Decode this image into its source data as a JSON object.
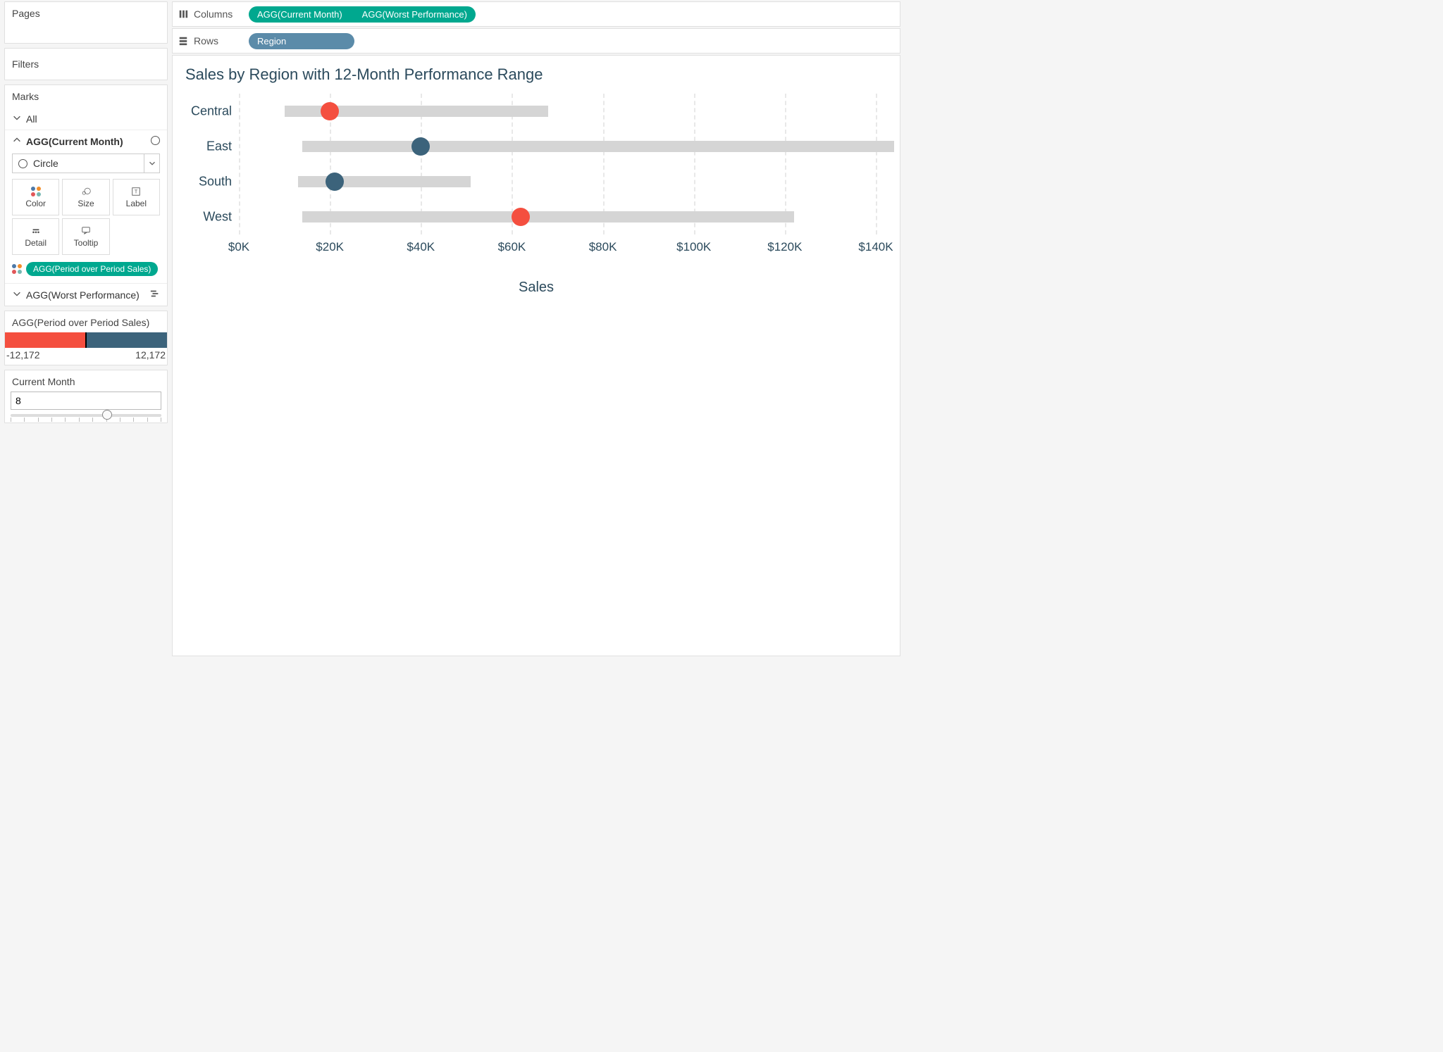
{
  "pages_label": "Pages",
  "filters_label": "Filters",
  "marks": {
    "header": "Marks",
    "all_label": "All",
    "section1_label": "AGG(Current Month)",
    "mark_type": "Circle",
    "cells": {
      "color": "Color",
      "size": "Size",
      "label": "Label",
      "detail": "Detail",
      "tooltip": "Tooltip"
    },
    "color_pill": "AGG(Period over Period Sales)",
    "section2_label": "AGG(Worst Performance)"
  },
  "legend": {
    "title": "AGG(Period over Period Sales)",
    "min": "-12,172",
    "max": "12,172"
  },
  "param": {
    "title": "Current Month",
    "value": "8"
  },
  "shelves": {
    "columns_label": "Columns",
    "rows_label": "Rows",
    "columns": [
      "AGG(Current Month)",
      "AGG(Worst Performance)"
    ],
    "rows": [
      "Region"
    ]
  },
  "viz": {
    "title": "Sales by Region with 12-Month Performance Range",
    "x_title": "Sales"
  },
  "chart_data": {
    "type": "range-dot",
    "x_label": "Sales",
    "x_domain": [
      0,
      140000
    ],
    "x_ticks": [
      "$0K",
      "$20K",
      "$40K",
      "$60K",
      "$80K",
      "$100K",
      "$120K",
      "$140K"
    ],
    "rows": [
      {
        "region": "Central",
        "range_min": 10000,
        "range_max": 68000,
        "current": 20000,
        "color": "negative"
      },
      {
        "region": "East",
        "range_min": 14000,
        "range_max": 144000,
        "current": 40000,
        "color": "positive"
      },
      {
        "region": "South",
        "range_min": 13000,
        "range_max": 51000,
        "current": 21000,
        "color": "positive"
      },
      {
        "region": "West",
        "range_min": 14000,
        "range_max": 122000,
        "current": 62000,
        "color": "negative"
      }
    ],
    "color_encoding": {
      "field": "AGG(Period over Period Sales)",
      "negative": "#f44f3f",
      "positive": "#3c637b"
    }
  }
}
